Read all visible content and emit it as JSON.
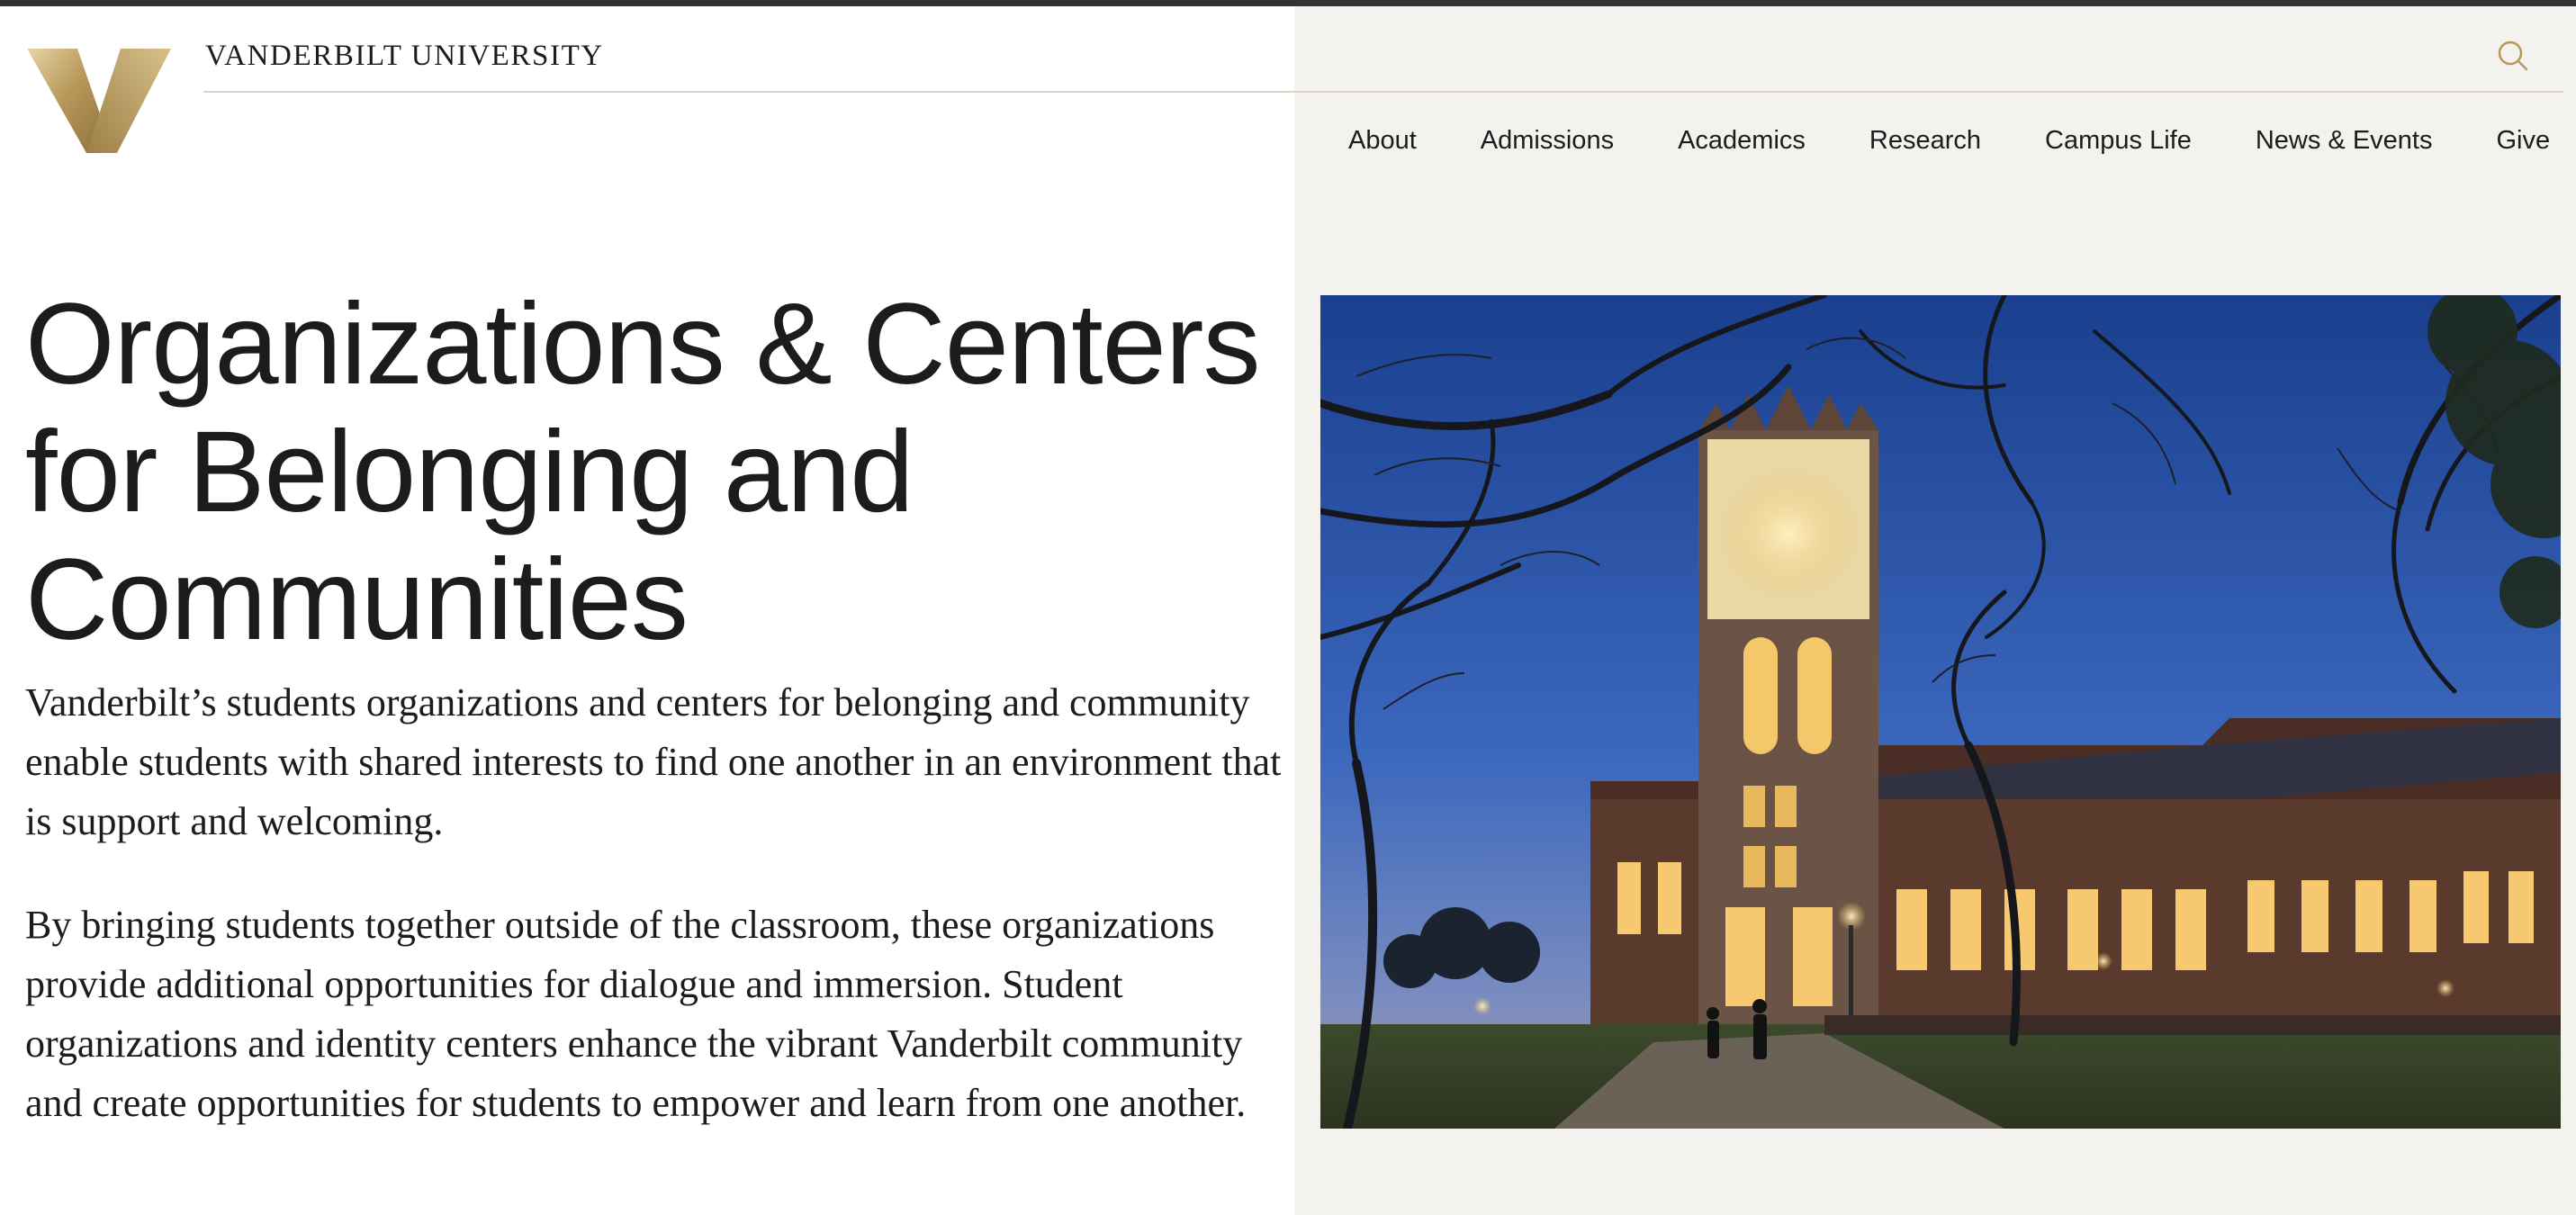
{
  "header": {
    "wordmark": "VANDERBILT UNIVERSITY",
    "logo_icon": "vanderbilt-v-logo",
    "search_icon": "search-icon"
  },
  "nav": {
    "items": [
      {
        "label": "About"
      },
      {
        "label": "Admissions"
      },
      {
        "label": "Academics"
      },
      {
        "label": "Research"
      },
      {
        "label": "Campus Life"
      },
      {
        "label": "News & Events"
      },
      {
        "label": "Give"
      }
    ]
  },
  "main": {
    "title_lines": [
      "Organizations & Centers",
      "for Belonging and",
      "Communities"
    ],
    "paragraphs": [
      "Vanderbilt’s students organizations and centers for belonging and community enable students with shared interests to find one another in an environment that is support and welcoming.",
      "By bringing students together outside of the classroom, these organizations provide additional opportunities for dialogue and immersion. Student organizations and identity centers enhance the vibrant Vanderbilt community and create opportunities for students to empower and learn from one another."
    ]
  },
  "colors": {
    "gold": "#b59a57",
    "text": "#1c1c1c",
    "panel": "#f3f2ef",
    "rule": "#d9d4c3",
    "topbar": "#333333"
  }
}
